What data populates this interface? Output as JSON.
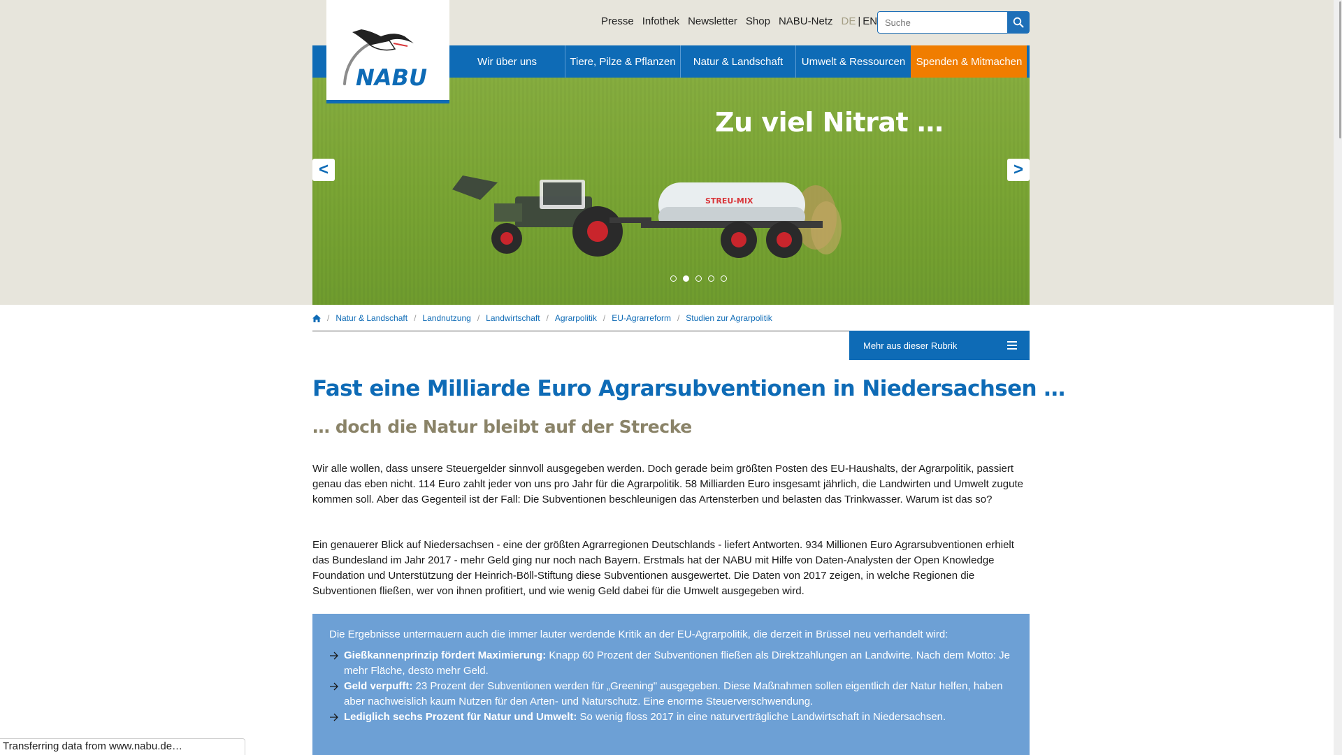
{
  "utility_nav": [
    "Presse",
    "Infothek",
    "Newsletter",
    "Shop",
    "NABU-Netz"
  ],
  "lang": {
    "de": "DE",
    "sep": "|",
    "en": "EN"
  },
  "search": {
    "placeholder": "Suche"
  },
  "logo": {
    "text": "NABU"
  },
  "main_nav": [
    "Wir über uns",
    "Tiere, Pilze & Pflanzen",
    "Natur & Landschaft",
    "Umwelt & Ressourcen",
    "Spenden & Mitmachen"
  ],
  "hero": {
    "title": "Zu viel Nitrat …",
    "prev": "<",
    "next": ">",
    "tank_label": "STREU-MIX",
    "slides": 5,
    "active_slide": 2
  },
  "breadcrumb": [
    "Natur & Landschaft",
    "Landnutzung",
    "Landwirtschaft",
    "Agrarpolitik",
    "EU-Agrarreform",
    "Studien zur Agrarpolitik"
  ],
  "rubrik": {
    "label": "Mehr aus dieser Rubrik"
  },
  "article": {
    "title": "Fast eine Milliarde Euro Agrarsubventionen in Niedersachsen …",
    "subtitle": "… doch die Natur bleibt auf der Strecke",
    "p1": "Wir alle wollen, dass unsere Steuergelder sinnvoll ausgegeben werden. Doch gerade beim größten Posten des EU-Haushalts, der Agrarpolitik, passiert genau das eben nicht. 114 Euro zahlt jeder von uns pro Jahr für die Agrarpolitik. 58 Milliarden Euro insgesamt jährlich, die Landwirten und Umwelt zugute kommen soll. Aber das Gegenteil ist der Fall: Die Subventionen beschleunigen das Artensterben und belasten das Trinkwasser. Warum ist das so?",
    "p2": "Ein genauerer Blick auf Niedersachsen - eine der größten Agrarregionen Deutschlands - liefert Antworten. 934 Millionen Euro Agrarsubventionen erhielt das Bundesland im Jahr 2017 - mehr Geld ging nur noch nach Bayern. Erstmals hat der NABU mit Hilfe von Daten-Analysten der Open Knowledge Foundation und Unterstützung der Heinrich-Böll-Stiftung diese Subventionen ausgewertet. Die Daten von 2017 zeigen, in welche Regionen die Subventionen fließen, wer von ihnen profitiert, und wie wenig Geld dabei für die Umwelt ausgegeben wird."
  },
  "infobox": {
    "intro": "Die Ergebnisse untermauern auch die immer lauter werdende Kritik an der EU-Agrarpolitik, die derzeit in Brüssel neu verhandelt wird:",
    "bullets": [
      {
        "bold": "Gießkannenprinzip fördert Maximierung:",
        "text": " Knapp 60 Prozent der Subventionen fließen als Direktzahlungen an Landwirte. Nach dem Motto: Je mehr Fläche, desto mehr Geld."
      },
      {
        "bold": "Geld verpufft:",
        "text": " 23 Prozent der Subventionen werden für „Greening\" ausgegeben. Diese Maßnahmen sollen eigentlich der Natur helfen, haben aber nachweislich kaum Nutzen für den Arten- und Naturschutz. Eine enorme Steuerverschwendung."
      },
      {
        "bold": "Lediglich sechs Prozent für Natur und Umwelt:",
        "text": " So wenig floss 2017 in eine naturverträgliche Landwirtschaft in Niedersachsen."
      }
    ]
  },
  "status": "Transferring data from www.nabu.de…",
  "colors": {
    "nabu_blue": "#0e6bb6",
    "orange": "#f07d00",
    "info_blue": "#6da0d5",
    "subtitle_gray": "#8a8368",
    "band_beige": "#e7e5dc"
  }
}
